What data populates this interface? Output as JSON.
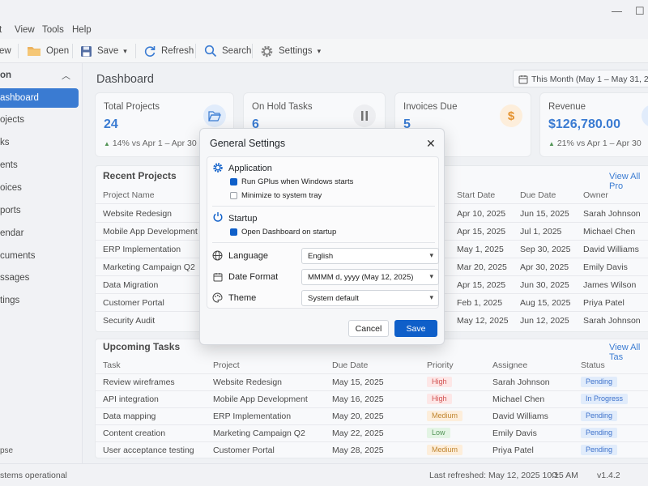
{
  "window": {
    "minimize": "—",
    "maximize": "☐"
  },
  "menu": [
    "t",
    "View",
    "Tools",
    "Help"
  ],
  "toolbar": {
    "new": "ew",
    "open": "Open",
    "save": "Save",
    "refresh": "Refresh",
    "search": "Search",
    "settings": "Settings"
  },
  "sidebar": {
    "header": "on",
    "items": [
      "ashboard",
      "ojects",
      "ks",
      "ents",
      "oices",
      "ports",
      "endar",
      "cuments",
      "ssages",
      "tings"
    ],
    "collapse": "pse"
  },
  "page": {
    "title": "Dashboard",
    "date_range": "This Month (May 1 – May 31, 2025)"
  },
  "kpis": [
    {
      "title": "Total Projects",
      "value": "24",
      "trend": "14% vs Apr 1 – Apr 30"
    },
    {
      "title": "On Hold Tasks",
      "value": "6",
      "trend": ""
    },
    {
      "title": "Invoices Due",
      "value": "5",
      "trend": ""
    },
    {
      "title": "Revenue",
      "value": "$126,780.00",
      "trend": "21% vs Apr 1 – Apr 30"
    }
  ],
  "recent_projects": {
    "title": "Recent Projects",
    "view_all": "View All Pro",
    "columns": [
      "Project Name",
      "Start Date",
      "Due Date",
      "Owner"
    ],
    "rows": [
      [
        "Website Redesign",
        "Apr 10, 2025",
        "Jun 15, 2025",
        "Sarah Johnson"
      ],
      [
        "Mobile App Development",
        "Apr 15, 2025",
        "Jul 1, 2025",
        "Michael Chen"
      ],
      [
        "ERP Implementation",
        "May 1, 2025",
        "Sep 30, 2025",
        "David Williams"
      ],
      [
        "Marketing Campaign Q2",
        "Mar 20, 2025",
        "Apr 30, 2025",
        "Emily Davis"
      ],
      [
        "Data Migration",
        "Apr 15, 2025",
        "Jun 30, 2025",
        "James Wilson"
      ],
      [
        "Customer Portal",
        "Feb 1, 2025",
        "Aug 15, 2025",
        "Priya Patel"
      ],
      [
        "Security Audit",
        "May 12, 2025",
        "Jun 12, 2025",
        "Sarah Johnson"
      ]
    ]
  },
  "upcoming_tasks": {
    "title": "Upcoming Tasks",
    "view_all": "View All Tas",
    "columns": [
      "Task",
      "Project",
      "Due Date",
      "Priority",
      "Assignee",
      "Status"
    ],
    "rows": [
      [
        "Review wireframes",
        "Website Redesign",
        "May 15, 2025",
        "High",
        "Sarah Johnson",
        "Pending"
      ],
      [
        "API integration",
        "Mobile App Development",
        "May 16, 2025",
        "High",
        "Michael Chen",
        "In Progress"
      ],
      [
        "Data mapping",
        "ERP Implementation",
        "May 20, 2025",
        "Medium",
        "David Williams",
        "Pending"
      ],
      [
        "Content creation",
        "Marketing Campaign Q2",
        "May 22, 2025",
        "Low",
        "Emily Davis",
        "Pending"
      ],
      [
        "User acceptance testing",
        "Customer Portal",
        "May 28, 2025",
        "Medium",
        "Priya Patel",
        "Pending"
      ]
    ]
  },
  "status": {
    "left": "stems operational",
    "refreshed": "Last refreshed: May 12, 2025 10:15 AM",
    "version": "v1.4.2"
  },
  "dialog": {
    "title": "General Settings",
    "application": {
      "heading": "Application",
      "opt1": "Run GPlus when Windows starts",
      "opt2": "Minimize to system tray"
    },
    "startup": {
      "heading": "Startup",
      "opt1": "Open Dashboard on startup"
    },
    "language": {
      "label": "Language",
      "value": "English"
    },
    "date_format": {
      "label": "Date Format",
      "value": "MMMM d, yyyy (May 12, 2025)"
    },
    "theme": {
      "label": "Theme",
      "value": "System default"
    },
    "cancel": "Cancel",
    "save": "Save"
  },
  "colors": {
    "accent": "#0f5fc9",
    "success": "#2e7d32",
    "warning": "#e07b00"
  }
}
